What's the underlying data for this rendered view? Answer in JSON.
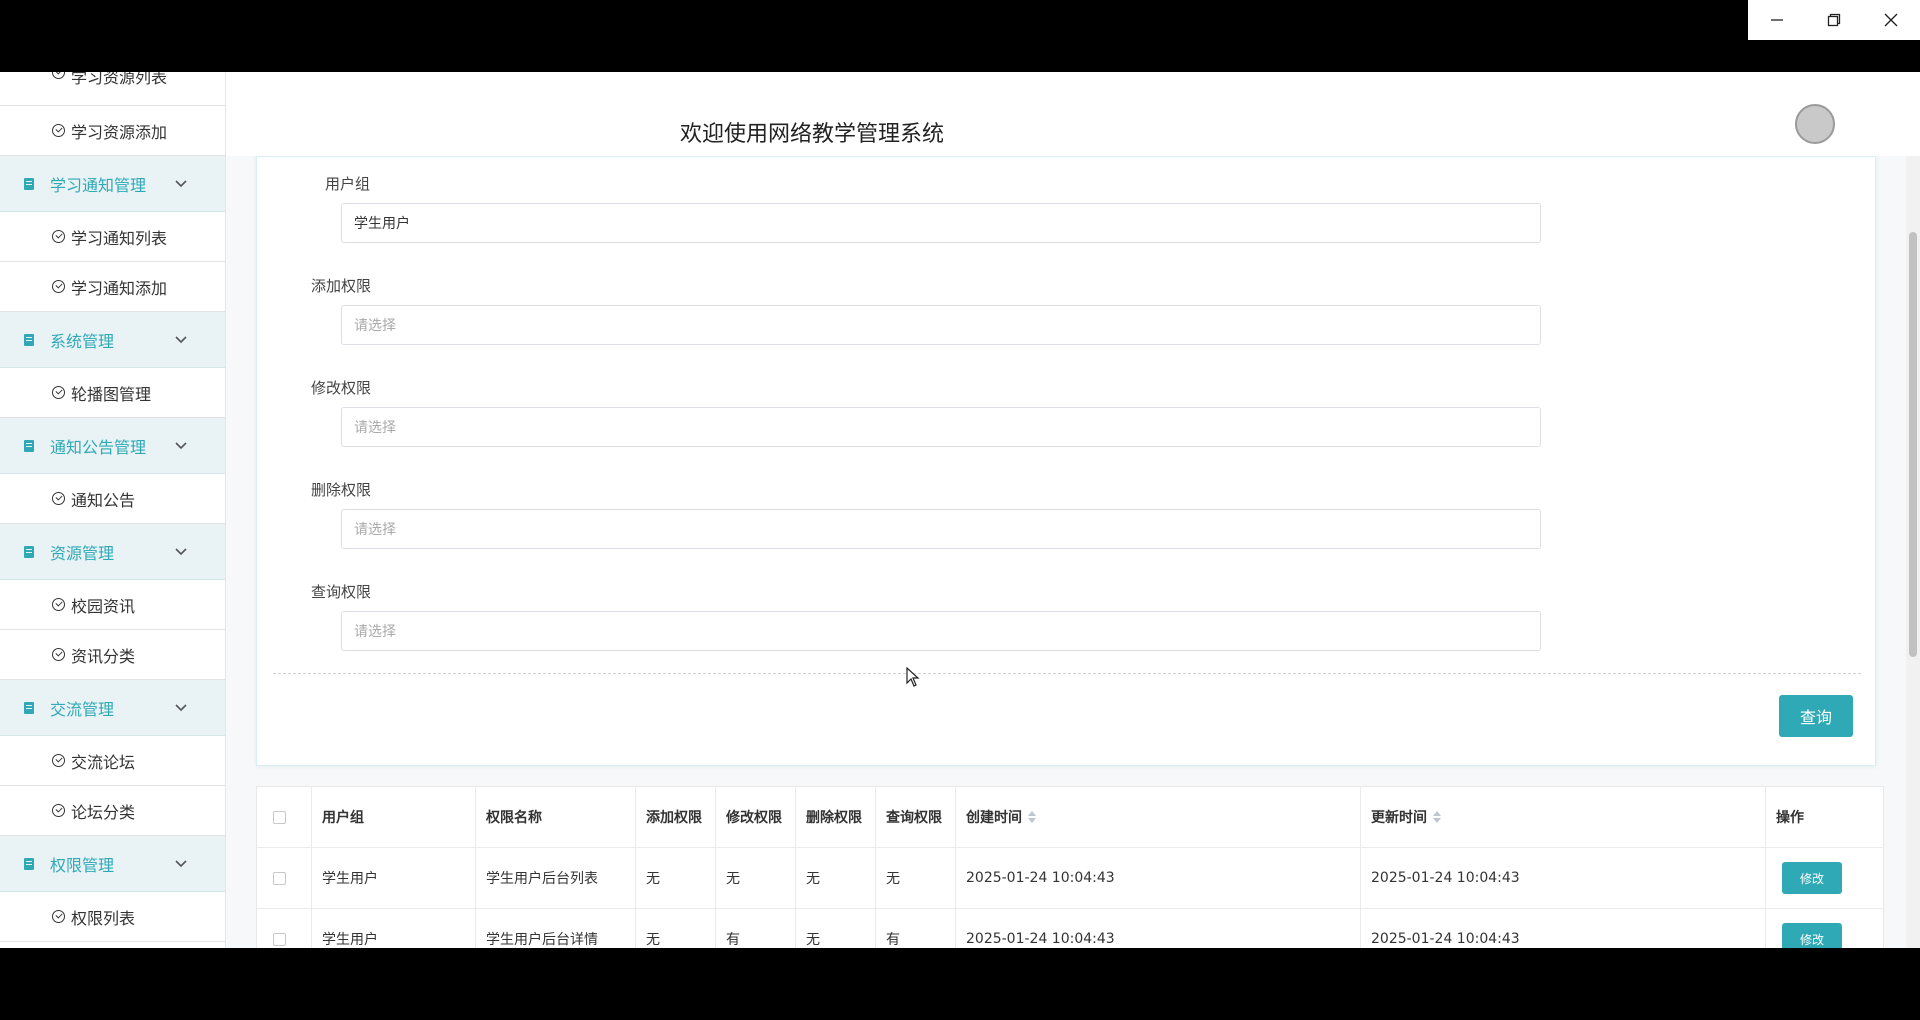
{
  "window": {
    "controls": {
      "minimize": "minimize",
      "restore": "restore",
      "close": "close"
    }
  },
  "header": {
    "title": "欢迎使用网络教学管理系统"
  },
  "sidebar": {
    "partial_top_label": "学习资源列表",
    "items": [
      {
        "type": "item",
        "label": "学习资源添加"
      },
      {
        "type": "group",
        "label": "学习通知管理"
      },
      {
        "type": "item",
        "label": "学习通知列表"
      },
      {
        "type": "item",
        "label": "学习通知添加"
      },
      {
        "type": "group",
        "label": "系统管理"
      },
      {
        "type": "item",
        "label": "轮播图管理"
      },
      {
        "type": "group",
        "label": "通知公告管理"
      },
      {
        "type": "item",
        "label": "通知公告"
      },
      {
        "type": "group",
        "label": "资源管理"
      },
      {
        "type": "item",
        "label": "校园资讯"
      },
      {
        "type": "item",
        "label": "资讯分类"
      },
      {
        "type": "group",
        "label": "交流管理"
      },
      {
        "type": "item",
        "label": "交流论坛"
      },
      {
        "type": "item",
        "label": "论坛分类"
      },
      {
        "type": "group",
        "label": "权限管理"
      },
      {
        "type": "item",
        "label": "权限列表"
      }
    ]
  },
  "form": {
    "user_group": {
      "label": "用户组",
      "value": "学生用户"
    },
    "add_perm": {
      "label": "添加权限",
      "placeholder": "请选择"
    },
    "edit_perm": {
      "label": "修改权限",
      "placeholder": "请选择"
    },
    "delete_perm": {
      "label": "删除权限",
      "placeholder": "请选择"
    },
    "query_perm": {
      "label": "查询权限",
      "placeholder": "请选择"
    },
    "query_button": "查询"
  },
  "table": {
    "headers": [
      "用户组",
      "权限名称",
      "添加权限",
      "修改权限",
      "删除权限",
      "查询权限",
      "创建时间",
      "更新时间",
      "操作"
    ],
    "rows": [
      {
        "group": "学生用户",
        "name": "学生用户后台列表",
        "add": "无",
        "edit": "无",
        "del": "无",
        "query": "无",
        "created": "2025-01-24 10:04:43",
        "updated": "2025-01-24 10:04:43",
        "action": "修改"
      },
      {
        "group": "学生用户",
        "name": "学生用户后台详情",
        "add": "无",
        "edit": "有",
        "del": "无",
        "query": "有",
        "created": "2025-01-24 10:04:43",
        "updated": "2025-01-24 10:04:43",
        "action": "修改"
      }
    ]
  },
  "colors": {
    "accent": "#2fa9b6",
    "group_bg": "#e9f2f4"
  }
}
